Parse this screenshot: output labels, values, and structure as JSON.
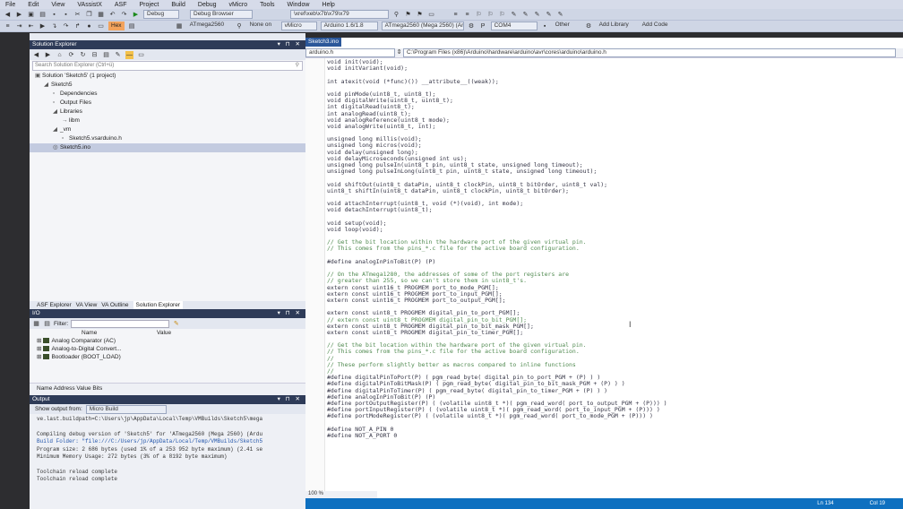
{
  "menu": [
    "File",
    "Edit",
    "View",
    "VAssistX",
    "ASF",
    "Project",
    "Build",
    "Debug",
    "vMicro",
    "Tools",
    "Window",
    "Help"
  ],
  "toolbar1": {
    "config": "Debug",
    "debug_browser": "Debug Browser",
    "xref": "\\xref\\xeb\\x7b\\x79\\x79",
    "platforms": [
      "P",
      "COM4",
      "Other",
      "Add Library",
      "Add Code"
    ]
  },
  "toolbar2": {
    "hex": "Hex",
    "chip": "ATmega2560",
    "port": "None on",
    "vmicro": "vMicro",
    "arduino": "Arduino 1.6/1.8",
    "board": "ATmega2560 (Mega 2560) (Ard"
  },
  "solution_explorer": {
    "title": "Solution Explorer",
    "search_placeholder": "Search Solution Explorer (Ctrl+ü)",
    "tree": [
      {
        "label": "Solution 'Sketch5' (1 project)",
        "indent": 0,
        "glyph": "▣"
      },
      {
        "label": "Sketch5",
        "indent": 1,
        "glyph": "◢"
      },
      {
        "label": "Dependencies",
        "indent": 2,
        "glyph": "▫"
      },
      {
        "label": "Output Files",
        "indent": 2,
        "glyph": "▫"
      },
      {
        "label": "Libraries",
        "indent": 2,
        "glyph": "◢"
      },
      {
        "label": "libm",
        "indent": 3,
        "glyph": "→"
      },
      {
        "label": "_vm",
        "indent": 2,
        "glyph": "◢"
      },
      {
        "label": "Sketch5.vsarduino.h",
        "indent": 3,
        "glyph": "▫"
      },
      {
        "label": "Sketch5.ino",
        "indent": 2,
        "glyph": "◎",
        "selected": true
      }
    ],
    "tabs": [
      "ASF Explorer",
      "VA View",
      "VA Outline",
      "Solution Explorer"
    ]
  },
  "io_panel": {
    "title": "I/O",
    "filter_label": "Filter:",
    "col_name": "Name",
    "col_value": "Value",
    "rows": [
      "Analog Comparator (AC)",
      "Analog-to-Digital Convert...",
      "Bootloader (BOOT_LOAD)"
    ],
    "desc": "Name Address Value Bits"
  },
  "output": {
    "title": "Output",
    "show_output_from": "Show output from:",
    "source": "Micro Build",
    "lines": [
      "ve.last.buildpath=C:\\Users\\jp\\AppData\\Local\\Temp\\VMBuilds\\Sketch5\\mega",
      "",
      "Compiling debug version of 'Sketch5' for 'ATmega2560 (Mega 2560) (Ardu",
      "Build Folder: \"file:///C:/Users/jp/AppData/Local/Temp/VMBuilds/Sketch5",
      "Program size: 2 686 bytes (used 1% of a 253 952 byte maximum) (2.41 se",
      "Minimum Memory Usage: 272 bytes (3% of a 8192 byte maximum)",
      "",
      "Toolchain reload complete",
      "Toolchain reload complete"
    ]
  },
  "editor": {
    "tab": "Sketch3.ino",
    "file_combo": "arduino.h",
    "path_combo": "C:\\Program Files (x86)\\Arduino\\hardware\\arduino\\avr\\cores\\arduino\\arduino.h",
    "zoom": "100 %",
    "status_ln": "Ln 134",
    "status_col": "Col 19",
    "code": [
      "void init(void);",
      "void initVariant(void);",
      "",
      "int atexit(void (*func)()) __attribute__((weak));",
      "",
      "void pinMode(uint8_t, uint8_t);",
      "void digitalWrite(uint8_t, uint8_t);",
      "int digitalRead(uint8_t);",
      "int analogRead(uint8_t);",
      "void analogReference(uint8_t mode);",
      "void analogWrite(uint8_t, int);",
      "",
      "unsigned long millis(void);",
      "unsigned long micros(void);",
      "void delay(unsigned long);",
      "void delayMicroseconds(unsigned int us);",
      "unsigned long pulseIn(uint8_t pin, uint8_t state, unsigned long timeout);",
      "unsigned long pulseInLong(uint8_t pin, uint8_t state, unsigned long timeout);",
      "",
      "void shiftOut(uint8_t dataPin, uint8_t clockPin, uint8_t bitOrder, uint8_t val);",
      "uint8_t shiftIn(uint8_t dataPin, uint8_t clockPin, uint8_t bitOrder);",
      "",
      "void attachInterrupt(uint8_t, void (*)(void), int mode);",
      "void detachInterrupt(uint8_t);",
      "",
      "void setup(void);",
      "void loop(void);",
      "",
      "// Get the bit location within the hardware port of the given virtual pin.",
      "// This comes from the pins_*.c file for the active board configuration.",
      "",
      "#define analogInPinToBit(P) (P)",
      "",
      "// On the ATmega1280, the addresses of some of the port registers are",
      "// greater than 255, so we can't store them in uint8_t's.",
      "extern const uint16_t PROGMEM port_to_mode_PGM[];",
      "extern const uint16_t PROGMEM port_to_input_PGM[];",
      "extern const uint16_t PROGMEM port_to_output_PGM[];",
      "",
      "extern const uint8_t PROGMEM digital_pin_to_port_PGM[];",
      "// extern const uint8_t PROGMEM digital_pin_to_bit_PGM[];",
      "extern const uint8_t PROGMEM digital_pin_to_bit_mask_PGM[];",
      "extern const uint8_t PROGMEM digital_pin_to_timer_PGM[];",
      "",
      "// Get the bit location within the hardware port of the given virtual pin.",
      "// This comes from the pins_*.c file for the active board configuration.",
      "//",
      "// These perform slightly better as macros compared to inline functions",
      "//",
      "#define digitalPinToPort(P) ( pgm_read_byte( digital_pin_to_port_PGM + (P) ) )",
      "#define digitalPinToBitMask(P) ( pgm_read_byte( digital_pin_to_bit_mask_PGM + (P) ) )",
      "#define digitalPinToTimer(P) ( pgm_read_byte( digital_pin_to_timer_PGM + (P) ) )",
      "#define analogInPinToBit(P) (P)",
      "#define portOutputRegister(P) ( (volatile uint8_t *)( pgm_read_word( port_to_output_PGM + (P))) )",
      "#define portInputRegister(P) ( (volatile uint8_t *)( pgm_read_word( port_to_input_PGM + (P))) )",
      "#define portModeRegister(P) ( (volatile uint8_t *)( pgm_read_word( port_to_mode_PGM + (P))) )",
      "",
      "#define NOT_A_PIN 0",
      "#define NOT_A_PORT 0"
    ]
  }
}
